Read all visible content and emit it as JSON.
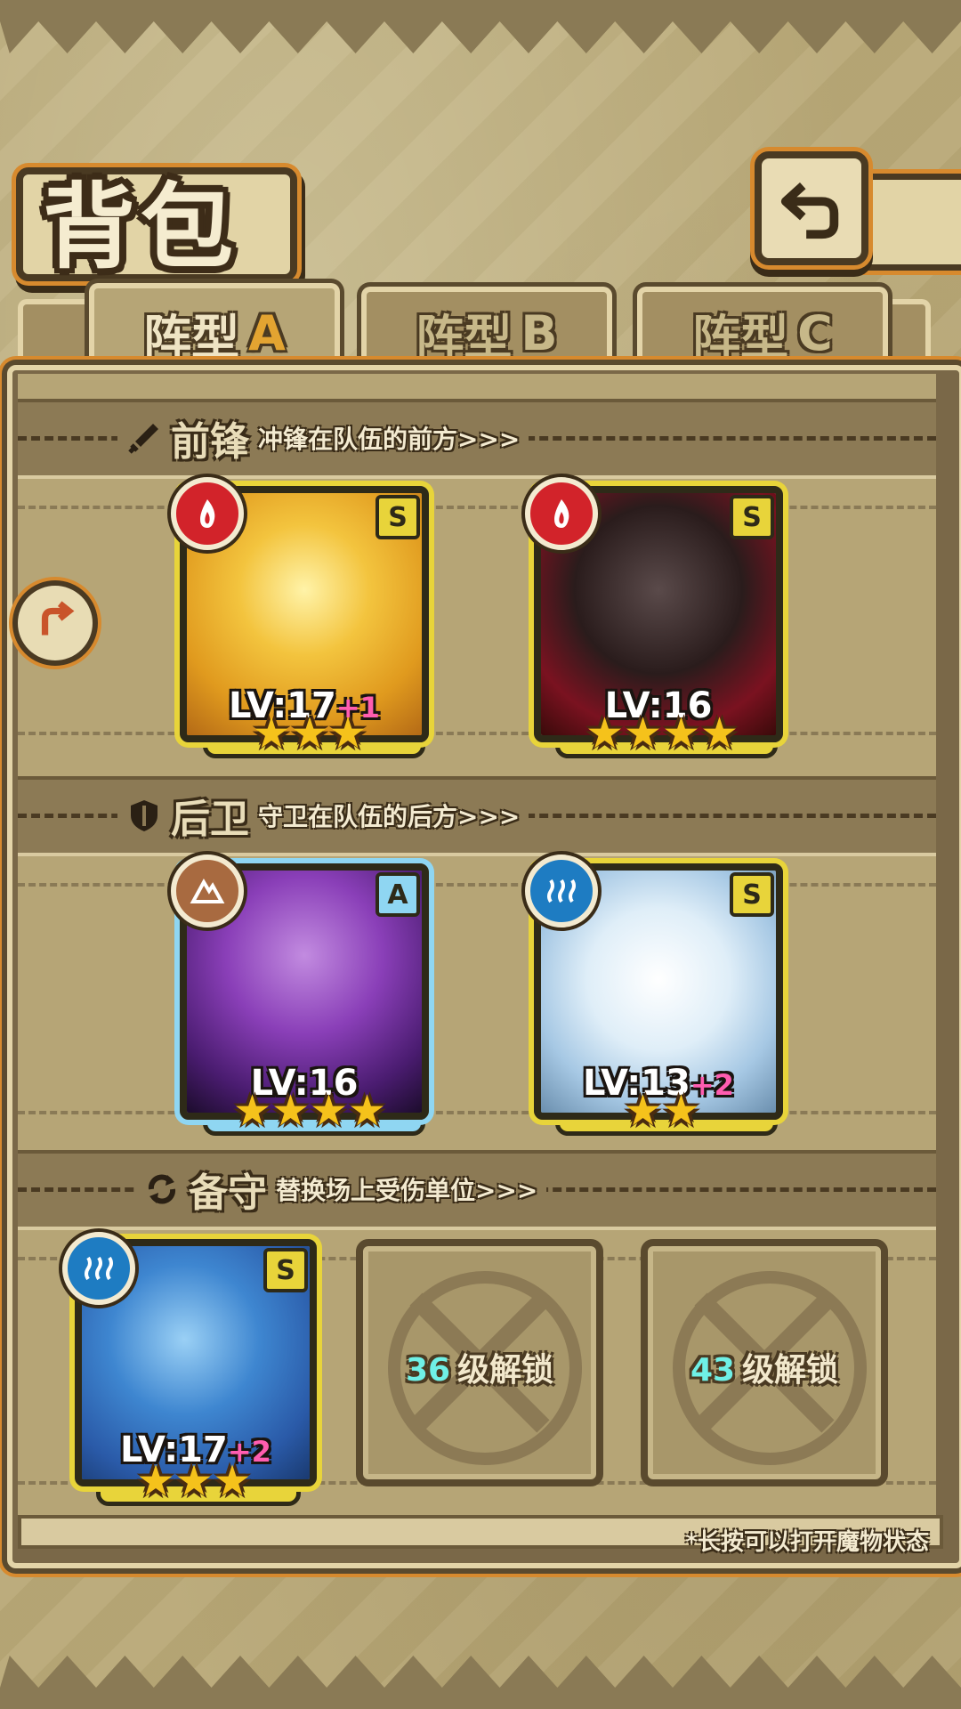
{
  "header": {
    "title": "背包"
  },
  "tabs": [
    {
      "label": "阵型",
      "letter": "A",
      "active": true
    },
    {
      "label": "阵型",
      "letter": "B",
      "active": false
    },
    {
      "label": "阵型",
      "letter": "C",
      "active": false
    }
  ],
  "sections": {
    "front": {
      "name": "前锋",
      "desc": "冲锋在队伍的前方>>>"
    },
    "back": {
      "name": "后卫",
      "desc": "守卫在队伍的后方>>>"
    },
    "reserve": {
      "name": "备守",
      "desc": "替换场上受伤单位>>>"
    }
  },
  "units": [
    {
      "level": "LV:17",
      "plus": "+1",
      "rank": "S",
      "element": "fire",
      "stars": "★★★"
    },
    {
      "level": "LV:16",
      "plus": "",
      "rank": "S",
      "element": "fire",
      "stars": "★★★★"
    },
    {
      "level": "LV:16",
      "plus": "",
      "rank": "A",
      "element": "earth",
      "stars": "★★★★"
    },
    {
      "level": "LV:13",
      "plus": "+2",
      "rank": "S",
      "element": "water",
      "stars": "★★"
    },
    {
      "level": "LV:17",
      "plus": "+2",
      "rank": "S",
      "element": "water",
      "stars": "★★★"
    }
  ],
  "locked": [
    {
      "level": "36",
      "text": "级解锁"
    },
    {
      "level": "43",
      "text": "级解锁"
    }
  ],
  "hint": "*长按可以打开魔物状态",
  "colors": {
    "accent": "#d78a2e",
    "frame": "#e8d43a",
    "frame_blue": "#8fd6f2",
    "fire": "#d2232a",
    "water": "#1e7cc2",
    "earth": "#a86a40"
  }
}
